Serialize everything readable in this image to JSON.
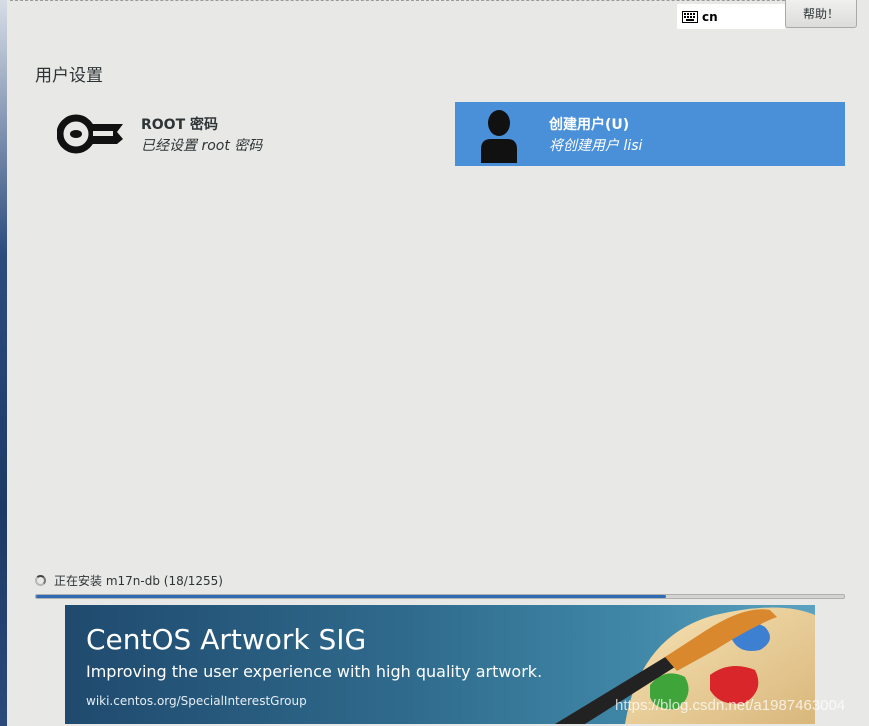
{
  "header": {
    "keyboard_layout": "cn",
    "help_button": "帮助！"
  },
  "section": {
    "title": "用户设置"
  },
  "spokes": {
    "root": {
      "title": "ROOT 密码",
      "status": "已经设置 root 密码"
    },
    "user": {
      "title": "创建用户(U)",
      "status": "将创建用户 lisi"
    }
  },
  "progress": {
    "text": "正在安装 m17n-db (18/1255)",
    "fraction": 0.78
  },
  "banner": {
    "title": "CentOS Artwork SIG",
    "subtitle": "Improving the user experience with high quality artwork.",
    "url": "wiki.centos.org/SpecialInterestGroup"
  },
  "watermark": "https://blog.csdn.net/a1987463004",
  "colors": {
    "accent": "#4a90d9",
    "progress": "#2f6bb5",
    "background": "#e8e8e7"
  }
}
